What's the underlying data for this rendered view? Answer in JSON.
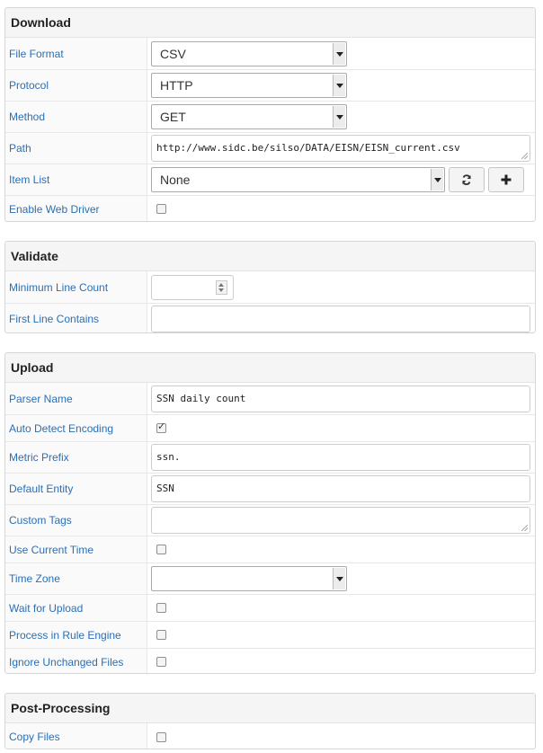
{
  "download": {
    "title": "Download",
    "file_format": {
      "label": "File Format",
      "value": "CSV"
    },
    "protocol": {
      "label": "Protocol",
      "value": "HTTP"
    },
    "method": {
      "label": "Method",
      "value": "GET"
    },
    "path": {
      "label": "Path",
      "value": "http://www.sidc.be/silso/DATA/EISN/EISN_current.csv"
    },
    "item_list": {
      "label": "Item List",
      "value": "None",
      "refresh_icon": "refresh-icon",
      "add_icon": "plus-icon"
    },
    "enable_web_driver": {
      "label": "Enable Web Driver",
      "checked": false
    }
  },
  "validate": {
    "title": "Validate",
    "min_line_count": {
      "label": "Minimum Line Count",
      "value": ""
    },
    "first_line_contains": {
      "label": "First Line Contains",
      "value": ""
    }
  },
  "upload": {
    "title": "Upload",
    "parser_name": {
      "label": "Parser Name",
      "value": "SSN daily count"
    },
    "auto_detect_encoding": {
      "label": "Auto Detect Encoding",
      "checked": true
    },
    "metric_prefix": {
      "label": "Metric Prefix",
      "value": "ssn."
    },
    "default_entity": {
      "label": "Default Entity",
      "value": "SSN"
    },
    "custom_tags": {
      "label": "Custom Tags",
      "value": ""
    },
    "use_current_time": {
      "label": "Use Current Time",
      "checked": false
    },
    "time_zone": {
      "label": "Time Zone",
      "value": ""
    },
    "wait_for_upload": {
      "label": "Wait for Upload",
      "checked": false
    },
    "process_in_rule_engine": {
      "label": "Process in Rule Engine",
      "checked": false
    },
    "ignore_unchanged_files": {
      "label": "Ignore Unchanged Files",
      "checked": false
    }
  },
  "post_processing": {
    "title": "Post-Processing",
    "copy_files": {
      "label": "Copy Files",
      "checked": false
    }
  }
}
